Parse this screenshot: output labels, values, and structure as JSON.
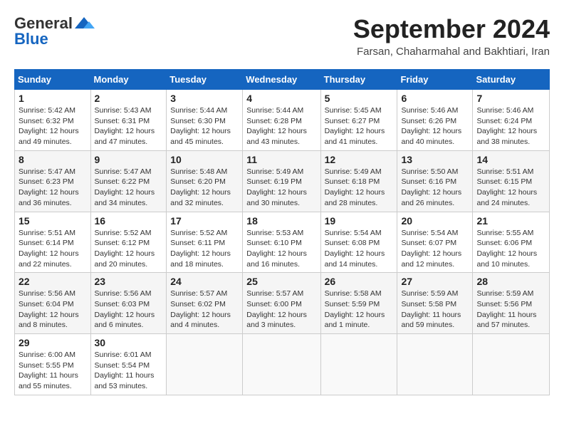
{
  "header": {
    "logo_general": "General",
    "logo_blue": "Blue",
    "month_year": "September 2024",
    "location": "Farsan, Chaharmahal and Bakhtiari, Iran"
  },
  "weekdays": [
    "Sunday",
    "Monday",
    "Tuesday",
    "Wednesday",
    "Thursday",
    "Friday",
    "Saturday"
  ],
  "weeks": [
    [
      {
        "day": "1",
        "info": "Sunrise: 5:42 AM\nSunset: 6:32 PM\nDaylight: 12 hours\nand 49 minutes."
      },
      {
        "day": "2",
        "info": "Sunrise: 5:43 AM\nSunset: 6:31 PM\nDaylight: 12 hours\nand 47 minutes."
      },
      {
        "day": "3",
        "info": "Sunrise: 5:44 AM\nSunset: 6:30 PM\nDaylight: 12 hours\nand 45 minutes."
      },
      {
        "day": "4",
        "info": "Sunrise: 5:44 AM\nSunset: 6:28 PM\nDaylight: 12 hours\nand 43 minutes."
      },
      {
        "day": "5",
        "info": "Sunrise: 5:45 AM\nSunset: 6:27 PM\nDaylight: 12 hours\nand 41 minutes."
      },
      {
        "day": "6",
        "info": "Sunrise: 5:46 AM\nSunset: 6:26 PM\nDaylight: 12 hours\nand 40 minutes."
      },
      {
        "day": "7",
        "info": "Sunrise: 5:46 AM\nSunset: 6:24 PM\nDaylight: 12 hours\nand 38 minutes."
      }
    ],
    [
      {
        "day": "8",
        "info": "Sunrise: 5:47 AM\nSunset: 6:23 PM\nDaylight: 12 hours\nand 36 minutes."
      },
      {
        "day": "9",
        "info": "Sunrise: 5:47 AM\nSunset: 6:22 PM\nDaylight: 12 hours\nand 34 minutes."
      },
      {
        "day": "10",
        "info": "Sunrise: 5:48 AM\nSunset: 6:20 PM\nDaylight: 12 hours\nand 32 minutes."
      },
      {
        "day": "11",
        "info": "Sunrise: 5:49 AM\nSunset: 6:19 PM\nDaylight: 12 hours\nand 30 minutes."
      },
      {
        "day": "12",
        "info": "Sunrise: 5:49 AM\nSunset: 6:18 PM\nDaylight: 12 hours\nand 28 minutes."
      },
      {
        "day": "13",
        "info": "Sunrise: 5:50 AM\nSunset: 6:16 PM\nDaylight: 12 hours\nand 26 minutes."
      },
      {
        "day": "14",
        "info": "Sunrise: 5:51 AM\nSunset: 6:15 PM\nDaylight: 12 hours\nand 24 minutes."
      }
    ],
    [
      {
        "day": "15",
        "info": "Sunrise: 5:51 AM\nSunset: 6:14 PM\nDaylight: 12 hours\nand 22 minutes."
      },
      {
        "day": "16",
        "info": "Sunrise: 5:52 AM\nSunset: 6:12 PM\nDaylight: 12 hours\nand 20 minutes."
      },
      {
        "day": "17",
        "info": "Sunrise: 5:52 AM\nSunset: 6:11 PM\nDaylight: 12 hours\nand 18 minutes."
      },
      {
        "day": "18",
        "info": "Sunrise: 5:53 AM\nSunset: 6:10 PM\nDaylight: 12 hours\nand 16 minutes."
      },
      {
        "day": "19",
        "info": "Sunrise: 5:54 AM\nSunset: 6:08 PM\nDaylight: 12 hours\nand 14 minutes."
      },
      {
        "day": "20",
        "info": "Sunrise: 5:54 AM\nSunset: 6:07 PM\nDaylight: 12 hours\nand 12 minutes."
      },
      {
        "day": "21",
        "info": "Sunrise: 5:55 AM\nSunset: 6:06 PM\nDaylight: 12 hours\nand 10 minutes."
      }
    ],
    [
      {
        "day": "22",
        "info": "Sunrise: 5:56 AM\nSunset: 6:04 PM\nDaylight: 12 hours\nand 8 minutes."
      },
      {
        "day": "23",
        "info": "Sunrise: 5:56 AM\nSunset: 6:03 PM\nDaylight: 12 hours\nand 6 minutes."
      },
      {
        "day": "24",
        "info": "Sunrise: 5:57 AM\nSunset: 6:02 PM\nDaylight: 12 hours\nand 4 minutes."
      },
      {
        "day": "25",
        "info": "Sunrise: 5:57 AM\nSunset: 6:00 PM\nDaylight: 12 hours\nand 3 minutes."
      },
      {
        "day": "26",
        "info": "Sunrise: 5:58 AM\nSunset: 5:59 PM\nDaylight: 12 hours\nand 1 minute."
      },
      {
        "day": "27",
        "info": "Sunrise: 5:59 AM\nSunset: 5:58 PM\nDaylight: 11 hours\nand 59 minutes."
      },
      {
        "day": "28",
        "info": "Sunrise: 5:59 AM\nSunset: 5:56 PM\nDaylight: 11 hours\nand 57 minutes."
      }
    ],
    [
      {
        "day": "29",
        "info": "Sunrise: 6:00 AM\nSunset: 5:55 PM\nDaylight: 11 hours\nand 55 minutes."
      },
      {
        "day": "30",
        "info": "Sunrise: 6:01 AM\nSunset: 5:54 PM\nDaylight: 11 hours\nand 53 minutes."
      },
      {
        "day": "",
        "info": ""
      },
      {
        "day": "",
        "info": ""
      },
      {
        "day": "",
        "info": ""
      },
      {
        "day": "",
        "info": ""
      },
      {
        "day": "",
        "info": ""
      }
    ]
  ]
}
